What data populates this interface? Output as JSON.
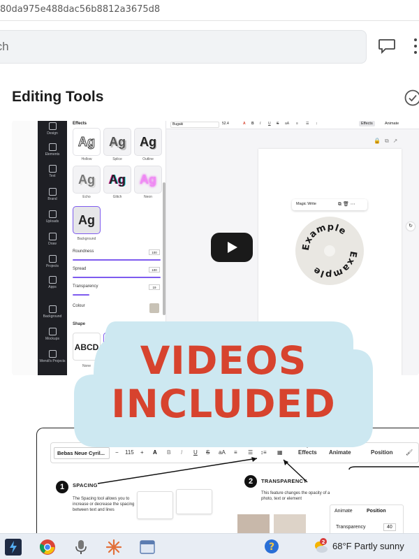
{
  "browser": {
    "url_fragment": "80da975e488dac56b8812a3675d8"
  },
  "search": {
    "placeholder": "rch"
  },
  "section": {
    "title": "Editing Tools"
  },
  "video": {
    "rail_items": [
      "Design",
      "Elements",
      "Text",
      "Brand",
      "Uploads",
      "Draw",
      "Projects",
      "Apps",
      "Background",
      "Mockups",
      "Wendi's Projects"
    ],
    "panel": {
      "title": "Effects",
      "effects": [
        "Hollow",
        "Splice",
        "Outline",
        "Echo",
        "Glitch",
        "Neon",
        "Background"
      ],
      "tile_text": "Ag",
      "rows": [
        {
          "label": "Roundness",
          "value": "100"
        },
        {
          "label": "Spread",
          "value": "100"
        },
        {
          "label": "Transparency",
          "value": "19"
        }
      ],
      "colour_label": "Colour",
      "shape_title": "Shape",
      "shape_tiles": [
        "ABCD",
        "AB"
      ],
      "shape_caption": "None"
    },
    "toolbar": {
      "font": "Bugaki",
      "size": "52.4",
      "effects": "Effects",
      "animate": "Animate"
    },
    "context": {
      "magic_write": "Magic Write"
    },
    "circle_text": "Example"
  },
  "promo": {
    "line1": "VIDEOS",
    "line2": "INCLUDED"
  },
  "infographic": {
    "toolbar": {
      "font": "Bebas Neue Cyril...",
      "size": "115",
      "effects": "Effects",
      "animate": "Animate",
      "position": "Position"
    },
    "step1": {
      "num": "1",
      "title": "SPACING",
      "desc": "The Spacing tool allows you to increase or decrease the spacing between text and lines"
    },
    "step2": {
      "num": "2",
      "title": "TRANSPARENCY",
      "desc": "This feature changes the opacity of a photo, text or element"
    },
    "card": {
      "animate": "Animate",
      "position": "Position",
      "transparency": "Transparency",
      "value": "40"
    }
  },
  "taskbar": {
    "weather": "68°F  Partly sunny",
    "notification_count": "2"
  }
}
